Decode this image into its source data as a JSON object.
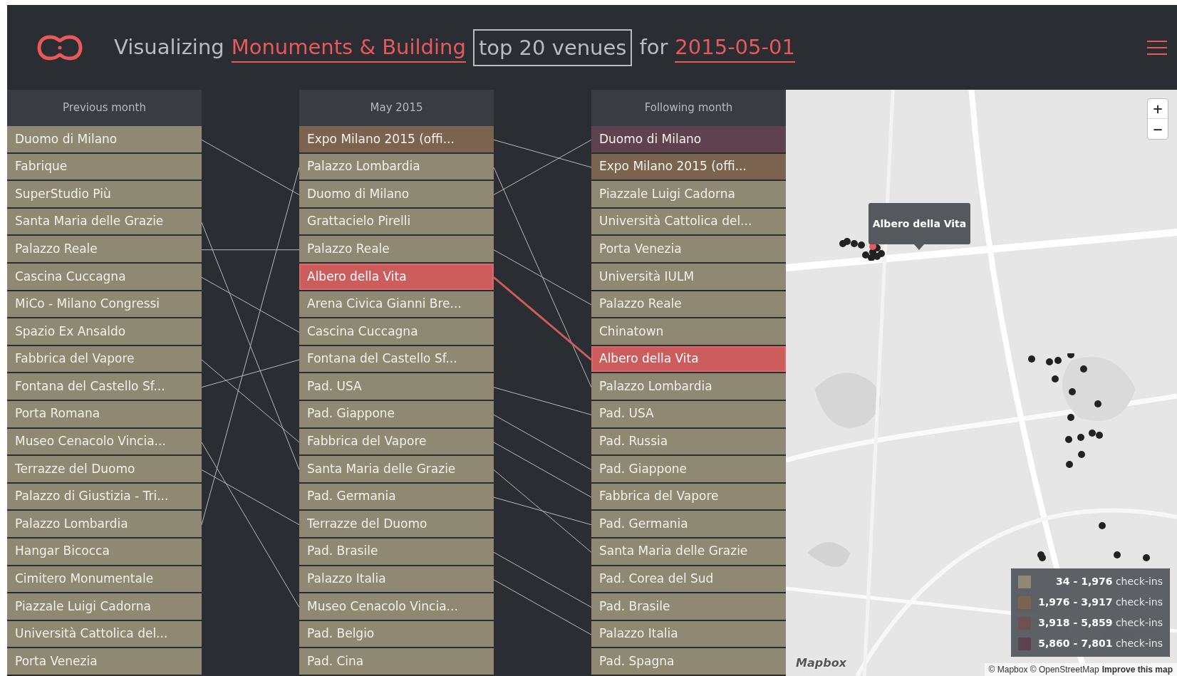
{
  "header": {
    "prefix": "Visualizing",
    "category": "Monuments & Building",
    "count_selector": "top 20 venues",
    "connector": "for",
    "date": "2015-05-01"
  },
  "columns": [
    {
      "title": "Previous month",
      "items": [
        {
          "name": "Duomo di Milano",
          "color": "#8f8872",
          "selected": false
        },
        {
          "name": "Fabrique",
          "color": "#8f8872",
          "selected": false
        },
        {
          "name": "SuperStudio Più",
          "color": "#8f8872",
          "selected": false
        },
        {
          "name": "Santa Maria delle Grazie",
          "color": "#8f8872",
          "selected": false
        },
        {
          "name": "Palazzo Reale",
          "color": "#8f8872",
          "selected": false
        },
        {
          "name": "Cascina Cuccagna",
          "color": "#8f8872",
          "selected": false
        },
        {
          "name": "MiCo - Milano Congressi",
          "color": "#8f8872",
          "selected": false
        },
        {
          "name": "Spazio Ex Ansaldo",
          "color": "#8f8872",
          "selected": false
        },
        {
          "name": "Fabbrica del Vapore",
          "color": "#8f8872",
          "selected": false
        },
        {
          "name": "Fontana del Castello Sf...",
          "color": "#8f8872",
          "selected": false
        },
        {
          "name": "Porta Romana",
          "color": "#8f8872",
          "selected": false
        },
        {
          "name": "Museo Cenacolo Vincia...",
          "color": "#8f8872",
          "selected": false
        },
        {
          "name": "Terrazze del Duomo",
          "color": "#8f8872",
          "selected": false
        },
        {
          "name": "Palazzo di Giustizia - Tri...",
          "color": "#8f8872",
          "selected": false
        },
        {
          "name": "Palazzo Lombardia",
          "color": "#8f8872",
          "selected": false
        },
        {
          "name": "Hangar Bicocca",
          "color": "#8f8872",
          "selected": false
        },
        {
          "name": "Cimitero Monumentale",
          "color": "#8f8872",
          "selected": false
        },
        {
          "name": "Piazzale Luigi Cadorna",
          "color": "#8f8872",
          "selected": false
        },
        {
          "name": "Università Cattolica del...",
          "color": "#8f8872",
          "selected": false
        },
        {
          "name": "Porta Venezia",
          "color": "#8f8872",
          "selected": false
        }
      ]
    },
    {
      "title": "May 2015",
      "items": [
        {
          "name": "Expo Milano 2015 (offi...",
          "color": "#7a6450",
          "selected": false
        },
        {
          "name": "Palazzo Lombardia",
          "color": "#8f8872",
          "selected": false
        },
        {
          "name": "Duomo di Milano",
          "color": "#8f8872",
          "selected": false
        },
        {
          "name": "Grattacielo Pirelli",
          "color": "#8f8872",
          "selected": false
        },
        {
          "name": "Palazzo Reale",
          "color": "#8f8872",
          "selected": false
        },
        {
          "name": "Albero della Vita",
          "color": "#cd5c5c",
          "selected": true
        },
        {
          "name": "Arena Civica Gianni Bre...",
          "color": "#8f8872",
          "selected": false
        },
        {
          "name": "Cascina Cuccagna",
          "color": "#8f8872",
          "selected": false
        },
        {
          "name": "Fontana del Castello Sf...",
          "color": "#8f8872",
          "selected": false
        },
        {
          "name": "Pad. USA",
          "color": "#8f8872",
          "selected": false
        },
        {
          "name": "Pad. Giappone",
          "color": "#8f8872",
          "selected": false
        },
        {
          "name": "Fabbrica del Vapore",
          "color": "#8f8872",
          "selected": false
        },
        {
          "name": "Santa Maria delle Grazie",
          "color": "#8f8872",
          "selected": false
        },
        {
          "name": "Pad. Germania",
          "color": "#8f8872",
          "selected": false
        },
        {
          "name": "Terrazze del Duomo",
          "color": "#8f8872",
          "selected": false
        },
        {
          "name": "Pad. Brasile",
          "color": "#8f8872",
          "selected": false
        },
        {
          "name": "Palazzo Italia",
          "color": "#8f8872",
          "selected": false
        },
        {
          "name": "Museo Cenacolo Vincia...",
          "color": "#8f8872",
          "selected": false
        },
        {
          "name": "Pad. Belgio",
          "color": "#8f8872",
          "selected": false
        },
        {
          "name": "Pad. Cina",
          "color": "#8f8872",
          "selected": false
        }
      ]
    },
    {
      "title": "Following month",
      "items": [
        {
          "name": "Duomo di Milano",
          "color": "#5e4250",
          "selected": false
        },
        {
          "name": "Expo Milano 2015 (offi...",
          "color": "#7a6450",
          "selected": false
        },
        {
          "name": "Piazzale Luigi Cadorna",
          "color": "#8f8872",
          "selected": false
        },
        {
          "name": "Università Cattolica del...",
          "color": "#8f8872",
          "selected": false
        },
        {
          "name": "Porta Venezia",
          "color": "#8f8872",
          "selected": false
        },
        {
          "name": "Università IULM",
          "color": "#8f8872",
          "selected": false
        },
        {
          "name": "Palazzo Reale",
          "color": "#8f8872",
          "selected": false
        },
        {
          "name": "Chinatown",
          "color": "#8f8872",
          "selected": false
        },
        {
          "name": "Albero della Vita",
          "color": "#cd5c5c",
          "selected": true
        },
        {
          "name": "Palazzo Lombardia",
          "color": "#8f8872",
          "selected": false
        },
        {
          "name": "Pad. USA",
          "color": "#8f8872",
          "selected": false
        },
        {
          "name": "Pad. Russia",
          "color": "#8f8872",
          "selected": false
        },
        {
          "name": "Pad. Giappone",
          "color": "#8f8872",
          "selected": false
        },
        {
          "name": "Fabbrica del Vapore",
          "color": "#8f8872",
          "selected": false
        },
        {
          "name": "Pad. Germania",
          "color": "#8f8872",
          "selected": false
        },
        {
          "name": "Santa Maria delle Grazie",
          "color": "#8f8872",
          "selected": false
        },
        {
          "name": "Pad. Corea del Sud",
          "color": "#8f8872",
          "selected": false
        },
        {
          "name": "Pad. Brasile",
          "color": "#8f8872",
          "selected": false
        },
        {
          "name": "Palazzo Italia",
          "color": "#8f8872",
          "selected": false
        },
        {
          "name": "Pad. Spagna",
          "color": "#8f8872",
          "selected": false
        }
      ]
    }
  ],
  "map": {
    "tooltip": "Albero della Vita",
    "zoom_in": "+",
    "zoom_out": "−",
    "legend": [
      {
        "range": "34 - 1,976",
        "unit": "check-ins",
        "color": "#8f8872"
      },
      {
        "range": "1,976 - 3,917",
        "unit": "check-ins",
        "color": "#7a6450"
      },
      {
        "range": "3,918 - 5,859",
        "unit": "check-ins",
        "color": "#6e5250"
      },
      {
        "range": "5,860 - 7,801",
        "unit": "check-ins",
        "color": "#5e4250"
      }
    ],
    "logo": "Mapbox",
    "attribution": "© Mapbox © OpenStreetMap",
    "improve_link": "Improve this map"
  }
}
